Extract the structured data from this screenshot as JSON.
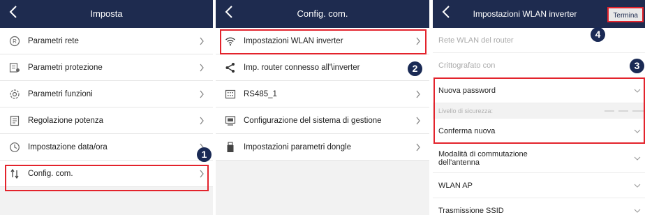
{
  "panel1": {
    "title": "Imposta",
    "items": [
      {
        "label": "Parametri rete",
        "icon": "network-params-icon"
      },
      {
        "label": "Parametri protezione",
        "icon": "protection-params-icon"
      },
      {
        "label": "Parametri funzioni",
        "icon": "function-params-icon"
      },
      {
        "label": "Regolazione potenza",
        "icon": "power-adjust-icon"
      },
      {
        "label": "Impostazione data/ora",
        "icon": "clock-icon"
      },
      {
        "label": "Config. com.",
        "icon": "comm-config-icon"
      }
    ],
    "marker": "1"
  },
  "panel2": {
    "title": "Config. com.",
    "items": [
      {
        "label": "Impostazioni WLAN inverter",
        "icon": "wifi-icon"
      },
      {
        "label": "Imp. router connesso all'\\inverter",
        "icon": "share-icon"
      },
      {
        "label": "RS485_1",
        "icon": "rs485-icon"
      },
      {
        "label": "Configurazione del sistema di gestione",
        "icon": "management-system-icon"
      },
      {
        "label": "Impostazioni parametri dongle",
        "icon": "dongle-icon"
      }
    ],
    "marker": "2"
  },
  "panel3": {
    "title": "Impostazioni WLAN inverter",
    "done_label": "Termina",
    "fields": {
      "router_wlan": "Rete WLAN del router",
      "encrypted_with": "Crittografato con",
      "new_password": "Nuova password",
      "security_level": "Livello di sicurezza:",
      "confirm_new": "Conferma nuova",
      "antenna_mode_line1": "Modalità di commutazione",
      "antenna_mode_line2": "dell'antenna",
      "wlan_ap": "WLAN AP",
      "ssid_broadcast": "Trasmissione SSID"
    },
    "marker_done": "4",
    "marker_fields": "3"
  },
  "colors": {
    "header_bg": "#1e2b4f",
    "highlight_red": "#e3232c",
    "marker_bg": "#1a2a55"
  }
}
